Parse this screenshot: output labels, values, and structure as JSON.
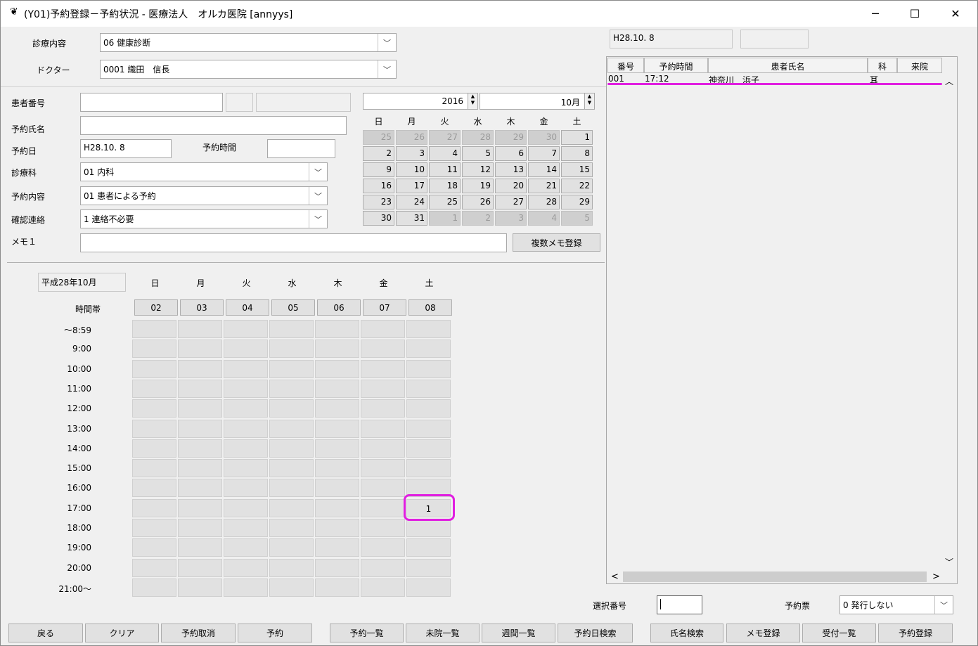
{
  "window": {
    "logo": "❦",
    "title": "(Y01)予約登録－予約状況 - 医療法人　オルカ医院  [annyys]",
    "min": "─",
    "max": "☐",
    "close": "✕"
  },
  "top": {
    "shinryo_naiyo_label": "診療内容",
    "shinryo_naiyo_value": "06 健康診断",
    "doctor_label": "ドクター",
    "doctor_value": "0001 織田　信長"
  },
  "form": {
    "patient_no_label": "患者番号",
    "patient_no_value": "",
    "name_label": "予約氏名",
    "name_value": "",
    "date_label": "予約日",
    "date_value": "H28.10. 8",
    "time_label": "予約時間",
    "time_value": "",
    "dept_label": "診療科",
    "dept_value": "01 内科",
    "content_label": "予約内容",
    "content_value": "01 患者による予約",
    "confirm_label": "確認連絡",
    "confirm_value": "1  連絡不必要",
    "memo_label": "メモ１",
    "memo_value": "",
    "multi_memo_button": "複数メモ登録"
  },
  "calendar": {
    "year": "2016",
    "month": "10月",
    "days_of_week": [
      "日",
      "月",
      "火",
      "水",
      "木",
      "金",
      "土"
    ],
    "weeks": [
      [
        "25",
        "26",
        "27",
        "28",
        "29",
        "30",
        "1"
      ],
      [
        "2",
        "3",
        "4",
        "5",
        "6",
        "7",
        "8"
      ],
      [
        "9",
        "10",
        "11",
        "12",
        "13",
        "14",
        "15"
      ],
      [
        "16",
        "17",
        "18",
        "19",
        "20",
        "21",
        "22"
      ],
      [
        "23",
        "24",
        "25",
        "26",
        "27",
        "28",
        "29"
      ],
      [
        "30",
        "31",
        "1",
        "2",
        "3",
        "4",
        "5"
      ]
    ]
  },
  "weekly": {
    "month_label": "平成28年10月",
    "days_of_week": [
      "日",
      "月",
      "火",
      "水",
      "木",
      "金",
      "土"
    ],
    "time_header": "時間帯",
    "dates": [
      "02",
      "03",
      "04",
      "05",
      "06",
      "07",
      "08"
    ],
    "times": [
      "～8:59",
      "9:00",
      "10:00",
      "11:00",
      "12:00",
      "13:00",
      "14:00",
      "15:00",
      "16:00",
      "17:00",
      "18:00",
      "19:00",
      "20:00",
      "21:00～"
    ],
    "counts": {
      "17:00": {
        "6": "1"
      }
    }
  },
  "right": {
    "date_display": "H28.10. 8",
    "blank_display": "",
    "columns": [
      "番号",
      "予約時間",
      "患者氏名",
      "科",
      "来院"
    ],
    "rows": [
      {
        "no": "001",
        "time": "17:12",
        "name": "神奈川　浜子",
        "dept": "耳",
        "visit": ""
      }
    ],
    "scroll_up": "︿",
    "scroll_down": "﹀",
    "scroll_left": "<",
    "scroll_right": ">"
  },
  "bottom": {
    "select_no_label": "選択番号",
    "select_no_value": "",
    "ticket_label": "予約票",
    "ticket_value": "0 発行しない",
    "buttons": [
      "戻る",
      "クリア",
      "予約取消",
      "予約",
      "予約一覧",
      "未院一覧",
      "週間一覧",
      "予約日検索",
      "氏名検索",
      "メモ登録",
      "受付一覧",
      "予約登録"
    ]
  },
  "highlight_color": "#e01fe0"
}
